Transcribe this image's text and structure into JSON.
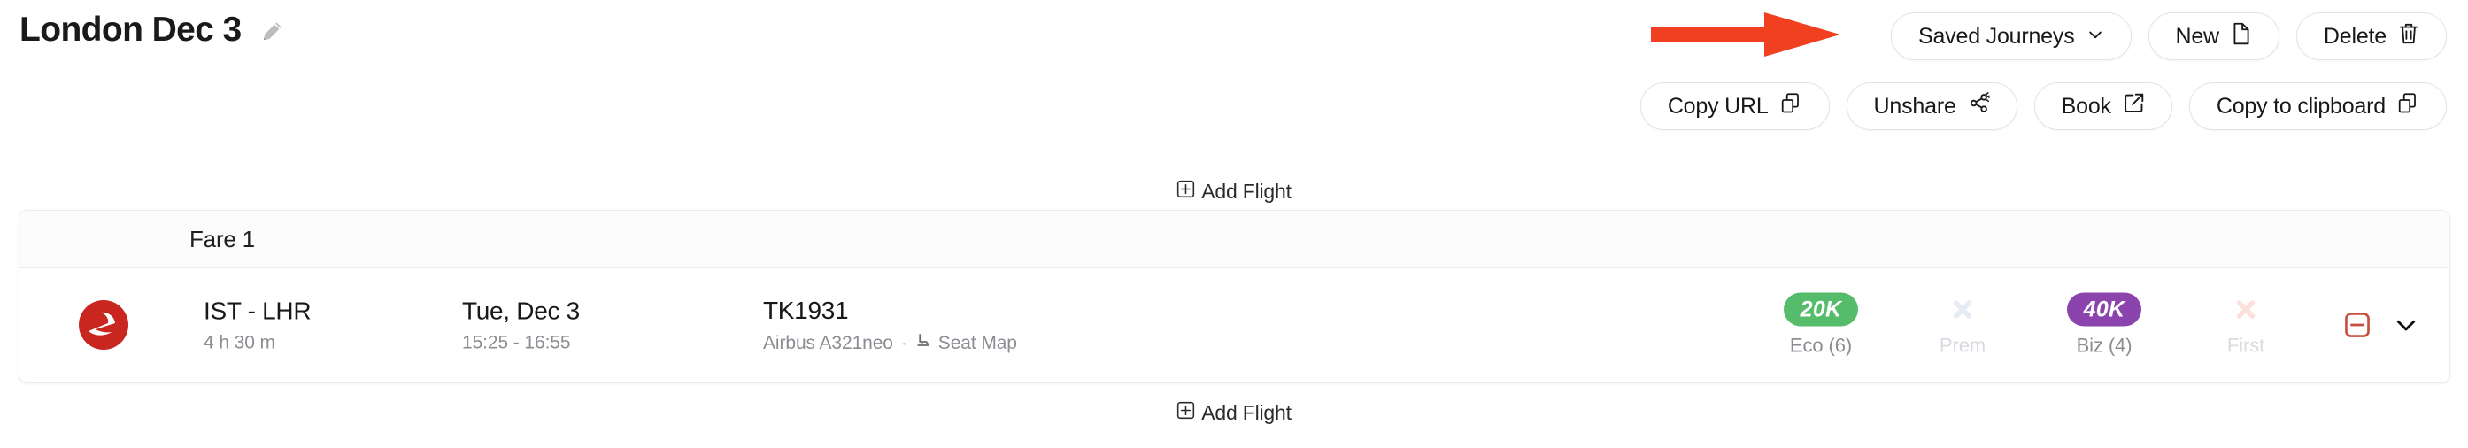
{
  "header": {
    "title": "London Dec 3",
    "edit_icon": "pencil-icon"
  },
  "annotation": {
    "type": "arrow",
    "points_to": "Saved Journeys",
    "color": "#f0401f"
  },
  "toolbar": {
    "row1": [
      {
        "label": "Saved Journeys",
        "icon": "chevron-down-icon",
        "name": "saved-journeys-button"
      },
      {
        "label": "New",
        "icon": "file-icon",
        "name": "new-button"
      },
      {
        "label": "Delete",
        "icon": "trash-icon",
        "name": "delete-button"
      }
    ],
    "row2": [
      {
        "label": "Copy URL",
        "icon": "copy-icon",
        "name": "copy-url-button"
      },
      {
        "label": "Unshare",
        "icon": "share-off-icon",
        "name": "unshare-button"
      },
      {
        "label": "Book",
        "icon": "external-link-icon",
        "name": "book-button"
      },
      {
        "label": "Copy to clipboard",
        "icon": "copy-icon",
        "name": "copy-to-clipboard-button"
      }
    ]
  },
  "add_flight": {
    "label": "Add Flight",
    "icon": "square-plus-icon"
  },
  "fare_card": {
    "fare_label": "Fare 1",
    "flight": {
      "airline_logo": "turkish-airlines-logo",
      "route": "IST - LHR",
      "duration": "4 h 30 m",
      "date": "Tue, Dec 3",
      "times": "15:25 - 16:55",
      "flight_number": "TK1931",
      "aircraft": "Airbus A321neo",
      "separator": "·",
      "seat_map_label": "Seat Map",
      "cabins": [
        {
          "label": "Eco (6)",
          "value": "20K",
          "available": true,
          "color": "#55bc6c"
        },
        {
          "label": "Prem",
          "value": "",
          "available": false,
          "color": "#e9eef5"
        },
        {
          "label": "Biz (4)",
          "value": "40K",
          "available": true,
          "color": "#8b44ad"
        },
        {
          "label": "First",
          "value": "",
          "available": false,
          "color": "#fbe3e0"
        }
      ],
      "actions": [
        {
          "name": "remove-flight-button",
          "icon": "square-minus-icon",
          "color": "#c94f3d"
        },
        {
          "name": "expand-row-button",
          "icon": "chevron-down-icon",
          "color": "#111111"
        }
      ]
    }
  }
}
